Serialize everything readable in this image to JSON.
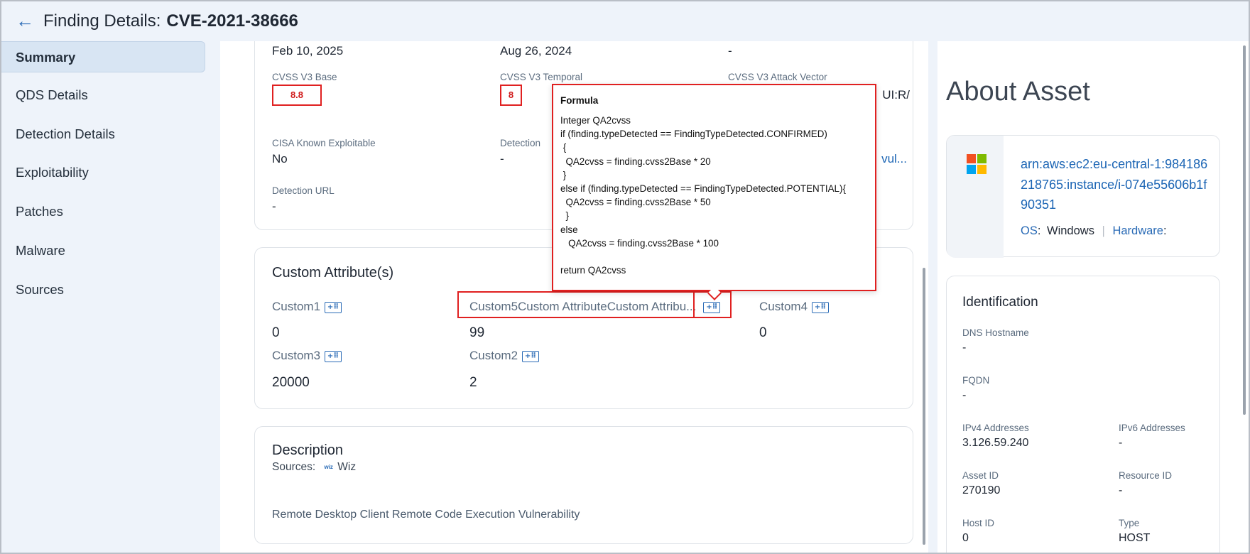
{
  "header": {
    "back_icon": "arrow-left-icon",
    "title": "Finding Details:",
    "cve": "CVE-2021-38666"
  },
  "sidebar": {
    "items": [
      {
        "label": "Summary",
        "active": true
      },
      {
        "label": "QDS Details"
      },
      {
        "label": "Detection Details"
      },
      {
        "label": "Exploitability"
      },
      {
        "label": "Patches"
      },
      {
        "label": "Malware"
      },
      {
        "label": "Sources"
      }
    ]
  },
  "details": {
    "row0": [
      "Feb 10, 2025",
      "Aug 26, 2024",
      "-"
    ],
    "cvss_v3_base_label": "CVSS V3 Base",
    "cvss_v3_base_value": "8.8",
    "cvss_v3_temporal_label": "CVSS V3 Temporal",
    "cvss_v3_temporal_value": "8",
    "cvss_v3_attack_vector_label": "CVSS V3 Attack Vector",
    "cvss_v3_attack_vector_value": "UI:R/",
    "cisa_label": "CISA Known Exploitable",
    "cisa_value": "No",
    "detection_label": "Detection",
    "detection_value": "-",
    "third_col_value": "vul...",
    "detection_url_label": "Detection URL",
    "detection_url_value": "-"
  },
  "custom_attributes": {
    "title": "Custom Attribute(s)",
    "items": [
      {
        "name": "Custom1",
        "value": "0"
      },
      {
        "name": "Custom5Custom AttributeCustom Attribu...",
        "value": "99"
      },
      {
        "name": "Custom4",
        "value": "0"
      },
      {
        "name": "Custom3",
        "value": "20000"
      },
      {
        "name": "Custom2",
        "value": "2"
      }
    ],
    "formula_icon": "formula-icon",
    "formula_icon_glyph": "+⠿"
  },
  "tooltip": {
    "title": "Formula",
    "lines": [
      "Integer QA2cvss",
      "if (finding.typeDetected == FindingTypeDetected.CONFIRMED)",
      " {",
      "  QA2cvss = finding.cvss2Base * 20",
      " }",
      "else if (finding.typeDetected == FindingTypeDetected.POTENTIAL){",
      "  QA2cvss = finding.cvss2Base * 50",
      "  }",
      "else",
      "   QA2cvss = finding.cvss2Base * 100",
      "",
      "return QA2cvss"
    ]
  },
  "description": {
    "title": "Description",
    "sources_label": "Sources:",
    "source_icon": "wiz-icon",
    "source_icon_text": "wiz",
    "source_name": "Wiz",
    "text": "Remote Desktop Client Remote Code Execution Vulnerability"
  },
  "about_asset": {
    "title": "About Asset",
    "logo_icon": "windows-logo-icon",
    "arn": "arn:aws:ec2:eu-central-1:984186218765:instance/i-074e55606b1f90351",
    "os_label": "OS",
    "os_value": "Windows",
    "hardware_label": "Hardware",
    "hardware_value": ""
  },
  "identification": {
    "title": "Identification",
    "fields": [
      {
        "label": "DNS Hostname",
        "value": "-"
      },
      {
        "label": "FQDN",
        "value": "-"
      },
      {
        "label": "IPv4 Addresses",
        "value": "3.126.59.240"
      },
      {
        "label": "IPv6 Addresses",
        "value": "-"
      },
      {
        "label": "Asset ID",
        "value": "270190"
      },
      {
        "label": "Resource ID",
        "value": "-"
      },
      {
        "label": "Host ID",
        "value": "0"
      },
      {
        "label": "Type",
        "value": "HOST"
      }
    ]
  },
  "colors": {
    "accent": "#2a6bb6",
    "highlight_red": "#e02020",
    "background": "#eef3fa"
  }
}
